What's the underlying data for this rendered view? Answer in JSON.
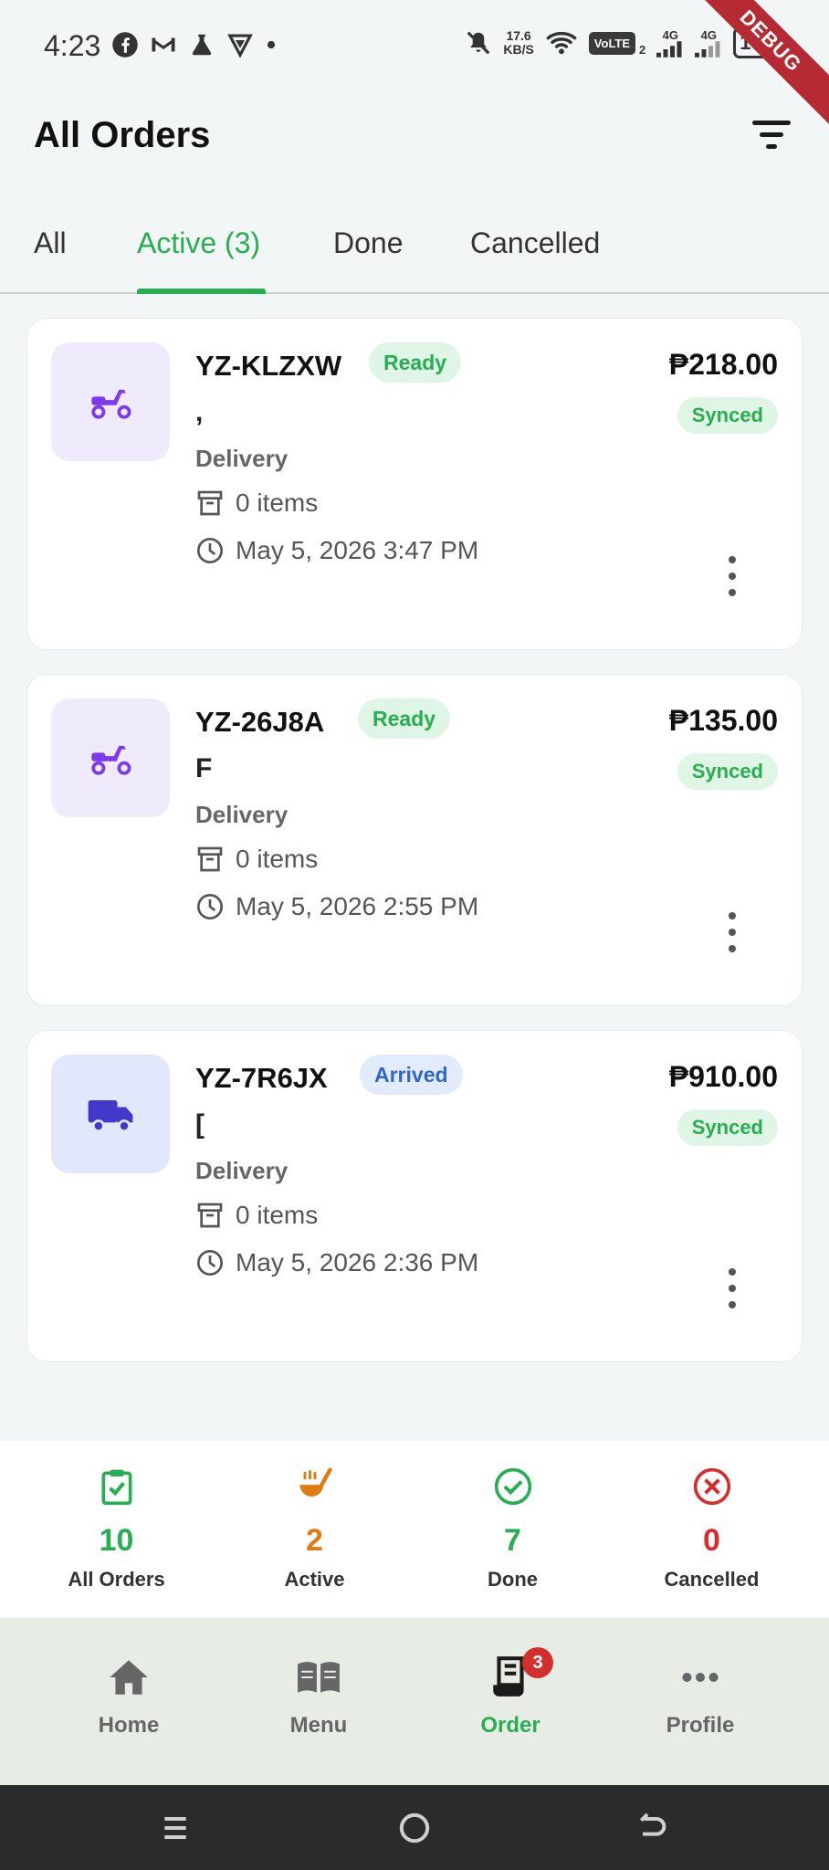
{
  "status_bar": {
    "time": "4:23",
    "speed_value": "17.6",
    "speed_unit": "KB/S",
    "volte": "VoLTE",
    "sim_slot": "2",
    "network_1": "4G",
    "network_2": "4G",
    "battery": "100",
    "debug_banner": "DEBUG"
  },
  "header": {
    "title": "All Orders",
    "filter_icon": "filter-lines-icon"
  },
  "tabs": [
    {
      "label": "All"
    },
    {
      "label": "Active (3)"
    },
    {
      "label": "Done"
    },
    {
      "label": "Cancelled"
    }
  ],
  "orders": [
    {
      "id": "YZ-KLZXW",
      "status": "Ready",
      "price": "₱218.00",
      "sync": "Synced",
      "customer": ",",
      "type": "Delivery",
      "items": "0 items",
      "date": "May 5, 2026 3:47 PM",
      "icon": "scooter-icon",
      "color": "#7c3aed"
    },
    {
      "id": "YZ-26J8A",
      "status": "Ready",
      "price": "₱135.00",
      "sync": "Synced",
      "customer": "F",
      "type": "Delivery",
      "items": "0 items",
      "date": "May 5, 2026 2:55 PM",
      "icon": "scooter-icon",
      "color": "#7c3aed"
    },
    {
      "id": "YZ-7R6JX",
      "status": "Arrived",
      "price": "₱910.00",
      "sync": "Synced",
      "customer": "[",
      "type": "Delivery",
      "items": "0 items",
      "date": "May 5, 2026 2:36 PM",
      "icon": "truck-icon",
      "color": "#4338ca"
    }
  ],
  "stats": [
    {
      "value": "10",
      "label": "All Orders",
      "color": "#27ae50",
      "icon": "clipboard-check-icon"
    },
    {
      "value": "2",
      "label": "Active",
      "color": "#e07b10",
      "icon": "cooking-ladle-icon"
    },
    {
      "value": "7",
      "label": "Done",
      "color": "#27ae50",
      "icon": "check-circle-icon"
    },
    {
      "value": "0",
      "label": "Cancelled",
      "color": "#d32f2f",
      "icon": "x-circle-icon"
    }
  ],
  "nav": [
    {
      "label": "Home",
      "icon": "home-icon"
    },
    {
      "label": "Menu",
      "icon": "book-icon"
    },
    {
      "label": "Order",
      "icon": "receipt-icon",
      "badge": "3"
    },
    {
      "label": "Profile",
      "icon": "more-horizontal-icon"
    }
  ],
  "colors": {
    "accent": "#27ae50",
    "background": "#f2f6f6"
  }
}
